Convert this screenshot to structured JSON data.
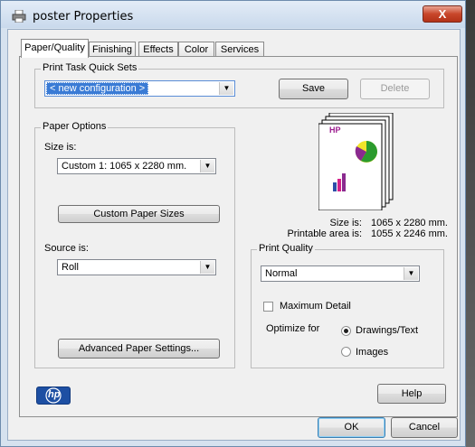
{
  "window": {
    "title": "poster Properties",
    "close_glyph": "X"
  },
  "tabs": [
    "Paper/Quality",
    "Finishing",
    "Effects",
    "Color",
    "Services"
  ],
  "quick_sets": {
    "legend": "Print Task Quick Sets",
    "value": "< new configuration >",
    "save_label": "Save",
    "delete_label": "Delete"
  },
  "paper_options": {
    "legend": "Paper Options",
    "size_label": "Size is:",
    "size_value": "Custom 1:  1065  x  2280 mm.",
    "custom_sizes_label": "Custom Paper Sizes",
    "source_label": "Source is:",
    "source_value": "Roll",
    "advanced_label": "Advanced Paper Settings..."
  },
  "preview": {
    "logo": "HP",
    "size_label": "Size is:",
    "size_value": "1065  x  2280 mm.",
    "printable_label": "Printable area is:",
    "printable_value": "1055  x  2246 mm."
  },
  "print_quality": {
    "legend": "Print Quality",
    "value": "Normal",
    "max_detail_label": "Maximum Detail",
    "max_detail_checked": false,
    "optimize_label": "Optimize for",
    "options": [
      "Drawings/Text",
      "Images"
    ],
    "selected": "Drawings/Text"
  },
  "footer": {
    "logo": "hp",
    "help_label": "Help",
    "ok_label": "OK",
    "cancel_label": "Cancel"
  },
  "colors": {
    "accent": "#1f5fbf",
    "close": "#c8462a",
    "title_bar": "#d6e2ef"
  }
}
